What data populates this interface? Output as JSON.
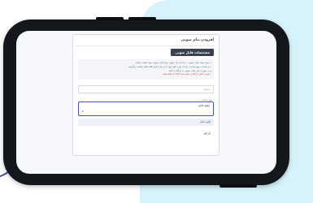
{
  "card": {
    "title": "افزودن پیام صوتی",
    "section_header": "مشخصات فایل صوتی",
    "notes": [
      "• نحوه ایجاد فایل صوتی : در ادامه یک عنوان برای فایل صوتی خود انتخاب نمائید.",
      "• از قسمت نوع ساخت، صدای مورد نظر خود را از میان گزینه های قابل انتخاب برگزینید",
      "و در صورت نیاز، فایل صوتی را بارگذاری کنید.",
      "• فرمت فایل بارگذاری شده باید mp3 یا wav باشد."
    ],
    "title_field_placeholder": "عنوان",
    "type_label": "نوع ساخت",
    "type_value": "آپلود فایل",
    "type_search": "v",
    "options": [
      "آپلود فایل",
      "اپراتور"
    ]
  }
}
